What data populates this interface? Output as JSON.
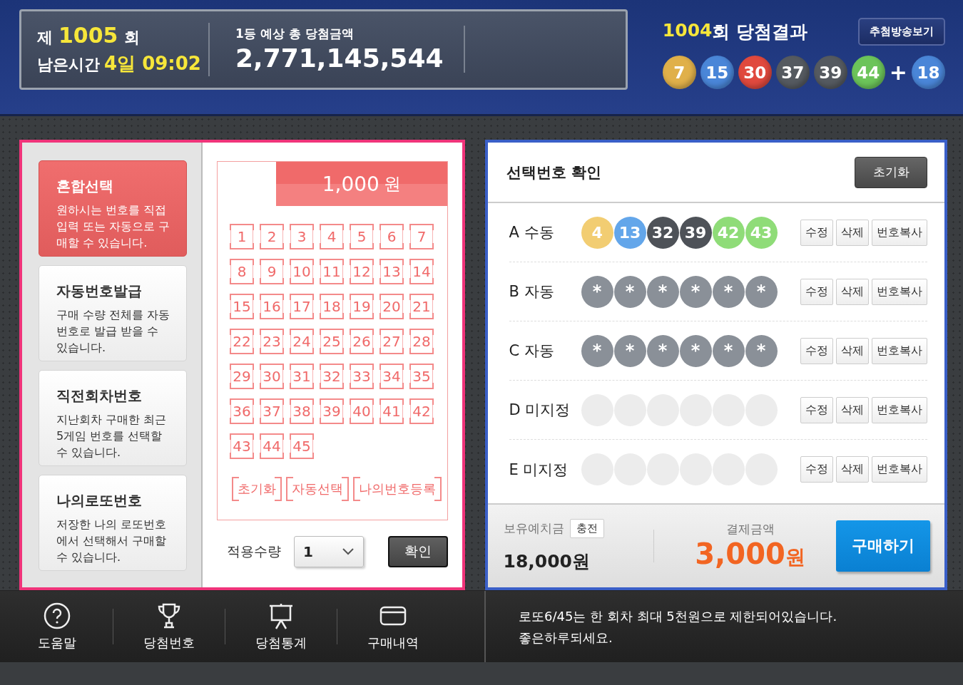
{
  "header": {
    "round_prefix": "제",
    "round": "1005",
    "round_suffix": "회",
    "remain_label": "남은시간",
    "remain_value": "4일 09:02",
    "jackpot_label": "1등 예상 총 당첨금액",
    "jackpot_value": "2,771,145,544",
    "result_round": "1004",
    "result_title": "회 당첨결과",
    "broadcast_button": "추첨방송보기",
    "winning_balls": [
      {
        "number": "7",
        "color": "#e0b04a"
      },
      {
        "number": "15",
        "color": "#4a86d8"
      },
      {
        "number": "30",
        "color": "#e0493e"
      },
      {
        "number": "37",
        "color": "#555a60"
      },
      {
        "number": "39",
        "color": "#555a60"
      },
      {
        "number": "44",
        "color": "#6cc45a"
      }
    ],
    "plus": "+",
    "bonus_ball": {
      "number": "18",
      "color": "#4a86d8"
    }
  },
  "modes": [
    {
      "title": "혼합선택",
      "description": "원하시는 번호를 직접 입력 또는 자동으로 구매할 수 있습니다.",
      "selected": true
    },
    {
      "title": "자동번호발급",
      "description": "구매 수량 전체를 자동 번호로 발급 받을 수 있습니다.",
      "selected": false
    },
    {
      "title": "직전회차번호",
      "description": "지난회차 구매한 최근 5게임 번호를 선택할 수 있습니다.",
      "selected": false
    },
    {
      "title": "나의로또번호",
      "description": "저장한 나의 로또번호에서 선택해서 구매할 수 있습니다.",
      "selected": false
    }
  ],
  "picker": {
    "price": "1,000",
    "price_unit": "원",
    "numbers": [
      "1",
      "2",
      "3",
      "4",
      "5",
      "6",
      "7",
      "8",
      "9",
      "10",
      "11",
      "12",
      "13",
      "14",
      "15",
      "16",
      "17",
      "18",
      "19",
      "20",
      "21",
      "22",
      "23",
      "24",
      "25",
      "26",
      "27",
      "28",
      "29",
      "30",
      "31",
      "32",
      "33",
      "34",
      "35",
      "36",
      "37",
      "38",
      "39",
      "40",
      "41",
      "42",
      "43",
      "44",
      "45"
    ],
    "actions": [
      "초기화",
      "자동선택",
      "나의번호등록"
    ],
    "quantity_label": "적용수량",
    "quantity": "1",
    "confirm_button": "확인"
  },
  "selection": {
    "title": "선택번호 확인",
    "reset_button": "초기화",
    "rows": [
      {
        "label": "A 수동",
        "kind": "manual",
        "balls": [
          {
            "number": "4",
            "color": "#f2cd72"
          },
          {
            "number": "13",
            "color": "#63a6ea"
          },
          {
            "number": "32",
            "color": "#4e5258"
          },
          {
            "number": "39",
            "color": "#4e5258"
          },
          {
            "number": "42",
            "color": "#8fdc78"
          },
          {
            "number": "43",
            "color": "#8fdc78"
          }
        ],
        "buttons": [
          "수정",
          "삭제",
          "번호복사"
        ]
      },
      {
        "label": "B 자동",
        "kind": "auto",
        "balls": [
          {
            "number": "*"
          },
          {
            "number": "*"
          },
          {
            "number": "*"
          },
          {
            "number": "*"
          },
          {
            "number": "*"
          },
          {
            "number": "*"
          }
        ],
        "buttons": [
          "수정",
          "삭제",
          "번호복사"
        ]
      },
      {
        "label": "C 자동",
        "kind": "auto",
        "balls": [
          {
            "number": "*"
          },
          {
            "number": "*"
          },
          {
            "number": "*"
          },
          {
            "number": "*"
          },
          {
            "number": "*"
          },
          {
            "number": "*"
          }
        ],
        "buttons": [
          "수정",
          "삭제",
          "번호복사"
        ]
      },
      {
        "label": "D 미지정",
        "kind": "empty",
        "buttons": [
          "수정",
          "삭제",
          "번호복사"
        ]
      },
      {
        "label": "E 미지정",
        "kind": "empty",
        "buttons": [
          "수정",
          "삭제",
          "번호복사"
        ]
      }
    ],
    "deposit_label": "보유예치금",
    "charge_button": "충전",
    "deposit_value": "18,000원",
    "payment_label": "결제금액",
    "payment_value": "3,000",
    "payment_unit": "원",
    "buy_button": "구매하기"
  },
  "footer": {
    "nav": [
      {
        "label": "도움말",
        "kind": "help"
      },
      {
        "label": "당첨번호",
        "kind": "trophy"
      },
      {
        "label": "당첨통계",
        "kind": "board"
      },
      {
        "label": "구매내역",
        "kind": "card"
      }
    ],
    "notices": [
      "로또6/45는 한 회차 최대 5천원으로 제한되어있습니다.",
      "좋은하루되세요."
    ]
  }
}
